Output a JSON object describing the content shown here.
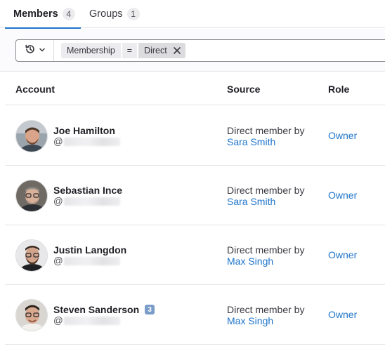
{
  "tabs": [
    {
      "label": "Members",
      "count": "4",
      "active": true
    },
    {
      "label": "Groups",
      "count": "1",
      "active": false
    }
  ],
  "filter": {
    "history_icon": "history-icon",
    "token": {
      "key": "Membership",
      "operator": "=",
      "value": "Direct"
    }
  },
  "table": {
    "headers": {
      "account": "Account",
      "source": "Source",
      "role": "Role"
    },
    "rows": [
      {
        "name": "Joe Hamilton",
        "username_prefix": "@",
        "badge": "",
        "source_text": "Direct member by",
        "source_link": "Sara Smith",
        "role": "Owner"
      },
      {
        "name": "Sebastian Ince",
        "username_prefix": "@",
        "badge": "",
        "source_text": "Direct member by",
        "source_link": "Sara Smith",
        "role": "Owner"
      },
      {
        "name": "Justin Langdon",
        "username_prefix": "@",
        "badge": "",
        "source_text": "Direct member by",
        "source_link": "Max Singh",
        "role": "Owner"
      },
      {
        "name": "Steven Sanderson",
        "username_prefix": "@",
        "badge": "3",
        "source_text": "Direct member by",
        "source_link": "Max Singh",
        "role": "Owner"
      }
    ]
  },
  "colors": {
    "link": "#1f75cb",
    "active_tab_underline": "#1f75cb",
    "badge": "#7a9cc9"
  }
}
